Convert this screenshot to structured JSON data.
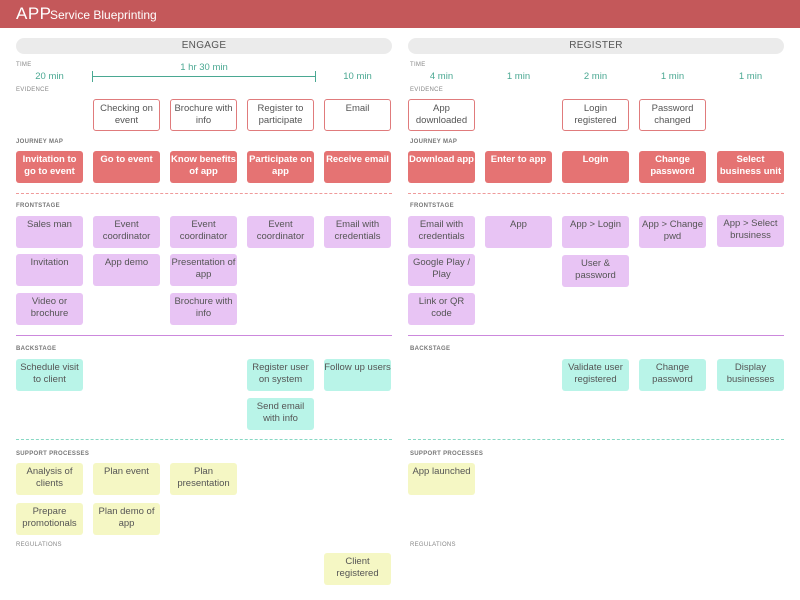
{
  "header": {
    "app": "APP",
    "title": "Service Blueprinting"
  },
  "colors": {
    "header": "#c4585a",
    "journey": "#e57373",
    "frontstage": "#e8c4f4",
    "backstage": "#b9f4e8",
    "support": "#f5f7c4",
    "time": "#4aa892"
  },
  "lanes": {
    "time": "TIME",
    "evidence": "EVIDENCE",
    "journey_map": "JOURNEY MAP",
    "frontstage": "FRONTSTAGE",
    "backstage": "BACKSTAGE",
    "support": "SUPPORT PROCESSES",
    "regulations": "REGULATIONS"
  },
  "engage": {
    "phase": "ENGAGE",
    "time": {
      "first": "20 min",
      "span": "1 hr 30 min",
      "last": "10 min"
    },
    "evidence": [
      "Checking on event",
      "Brochure with info",
      "Register to participate",
      "Email"
    ],
    "journey": [
      "Invitation to go to event",
      "Go to event",
      "Know benefits of app",
      "Participate on app",
      "Receive email"
    ],
    "frontstage": [
      [
        "Sales man",
        "Invitation",
        "Video or brochure"
      ],
      [
        "Event coordinator",
        "App demo"
      ],
      [
        "Event coordinator",
        "Presentation of app",
        "Brochure with info"
      ],
      [
        "Event coordinator"
      ],
      [
        "Email with credentials"
      ]
    ],
    "backstage": {
      "col1": [
        "Schedule visit to client"
      ],
      "col4": [
        "Register user on system",
        "Send email with info"
      ],
      "col5": [
        "Follow up users"
      ]
    },
    "support": {
      "col1": [
        "Analysis of clients",
        "Prepare promotionals"
      ],
      "col2": [
        "Plan event",
        "Plan demo of app"
      ],
      "col3": [
        "Plan presentation"
      ]
    },
    "regulations": {
      "col5": [
        "Client registered"
      ]
    }
  },
  "register": {
    "phase": "REGISTER",
    "time": [
      "4 min",
      "1 min",
      "2 min",
      "1 min",
      "1 min"
    ],
    "evidence": {
      "col1": "App downloaded",
      "col3": "Login registered",
      "col4": "Password changed"
    },
    "journey": [
      "Download app",
      "Enter to app",
      "Login",
      "Change password",
      "Select business unit"
    ],
    "frontstage": [
      [
        "Email with credentials",
        "Google Play / Play",
        "Link or QR code"
      ],
      [
        "App"
      ],
      [
        "App > Login",
        "User & password"
      ],
      [
        "App > Change pwd"
      ],
      [
        "App > Select brusiness"
      ]
    ],
    "backstage": {
      "col3": "Validate user registered",
      "col4": "Change password",
      "col5": "Display businesses"
    },
    "support": {
      "col1": "App launched"
    }
  }
}
